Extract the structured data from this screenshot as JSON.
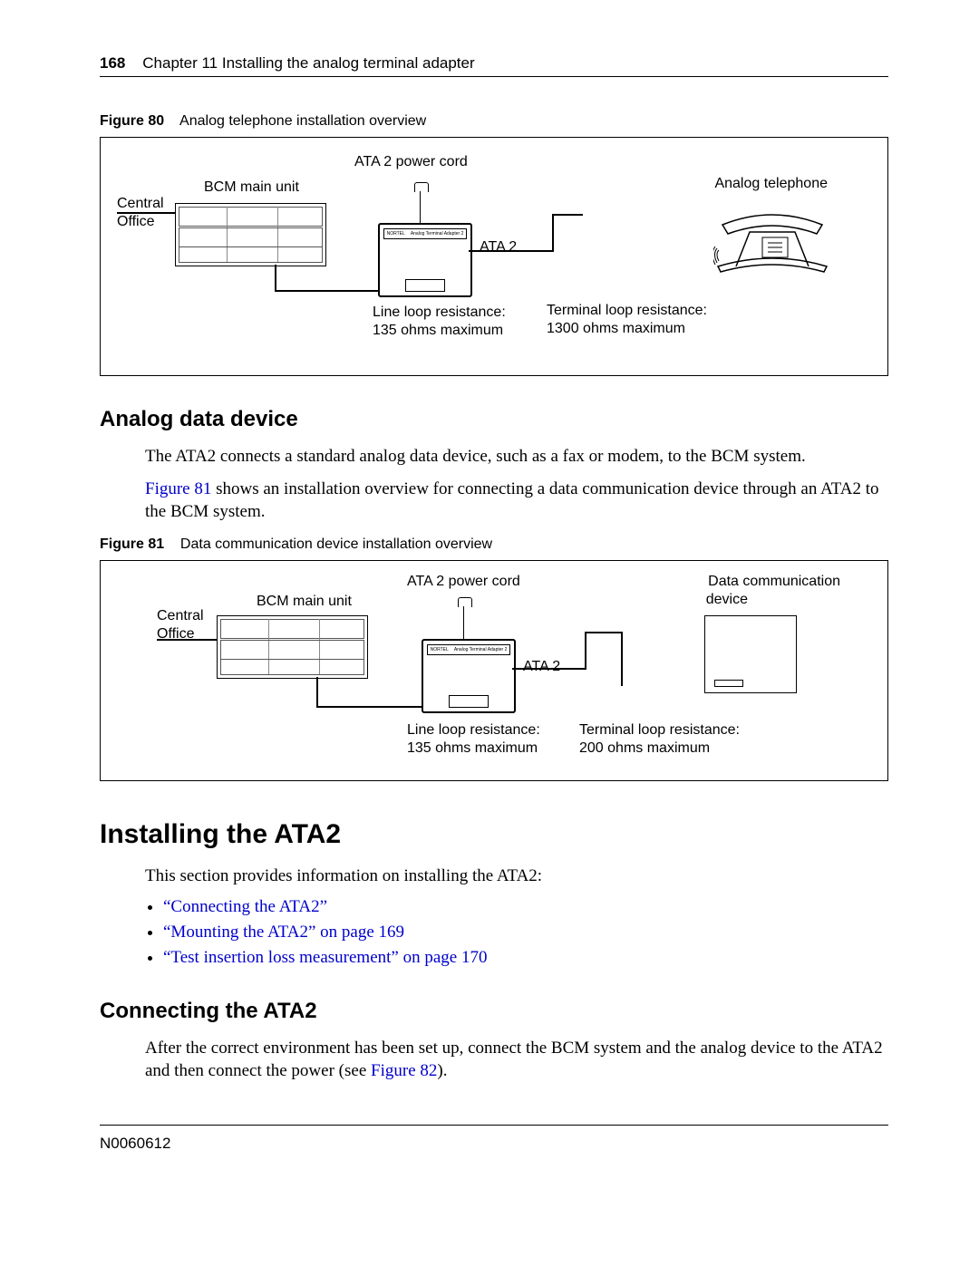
{
  "header": {
    "page_number": "168",
    "chapter": "Chapter 11  Installing the analog terminal adapter"
  },
  "figure80": {
    "caption_prefix": "Figure 80",
    "caption_text": "Analog telephone installation overview",
    "labels": {
      "ata_power_cord": "ATA 2 power cord",
      "bcm_main_unit": "BCM main unit",
      "analog_telephone": "Analog telephone",
      "central_office_l1": "Central",
      "central_office_l2": "Office",
      "ata2": "ATA 2",
      "line_loop_l1": "Line loop resistance:",
      "line_loop_l2": "135 ohms maximum",
      "terminal_loop_l1": "Terminal loop resistance:",
      "terminal_loop_l2": "1300 ohms maximum"
    }
  },
  "section_analog_data": {
    "heading": "Analog data device",
    "para1": "The ATA2 connects a standard analog data device, such as a fax or modem, to the BCM system.",
    "para2_before_link": "",
    "para2_link": "Figure 81",
    "para2_after_link": " shows an installation overview for connecting a data communication device through an ATA2 to the BCM system."
  },
  "figure81": {
    "caption_prefix": "Figure 81",
    "caption_text": "Data communication device installation overview",
    "labels": {
      "ata_power_cord": "ATA 2 power cord",
      "bcm_main_unit": "BCM main unit",
      "data_comm_l1": "Data communication",
      "data_comm_l2": "device",
      "central_office_l1": "Central",
      "central_office_l2": "Office",
      "ata2": "ATA 2",
      "line_loop_l1": "Line loop resistance:",
      "line_loop_l2": "135 ohms maximum",
      "terminal_loop_l1": "Terminal loop resistance:",
      "terminal_loop_l2": "200 ohms maximum"
    }
  },
  "section_install": {
    "heading": "Installing the ATA2",
    "intro": "This section provides information on installing the ATA2:",
    "bullets": [
      "“Connecting the ATA2”",
      "“Mounting the ATA2” on page 169",
      "“Test insertion loss measurement” on page 170"
    ]
  },
  "section_connecting": {
    "heading": "Connecting the ATA2",
    "para_before_link": "After the correct environment has been set up, connect the BCM system and the analog device to the ATA2 and then connect the power (see ",
    "link": "Figure 82",
    "para_after_link": ")."
  },
  "footer": {
    "doc_number": "N0060612"
  }
}
